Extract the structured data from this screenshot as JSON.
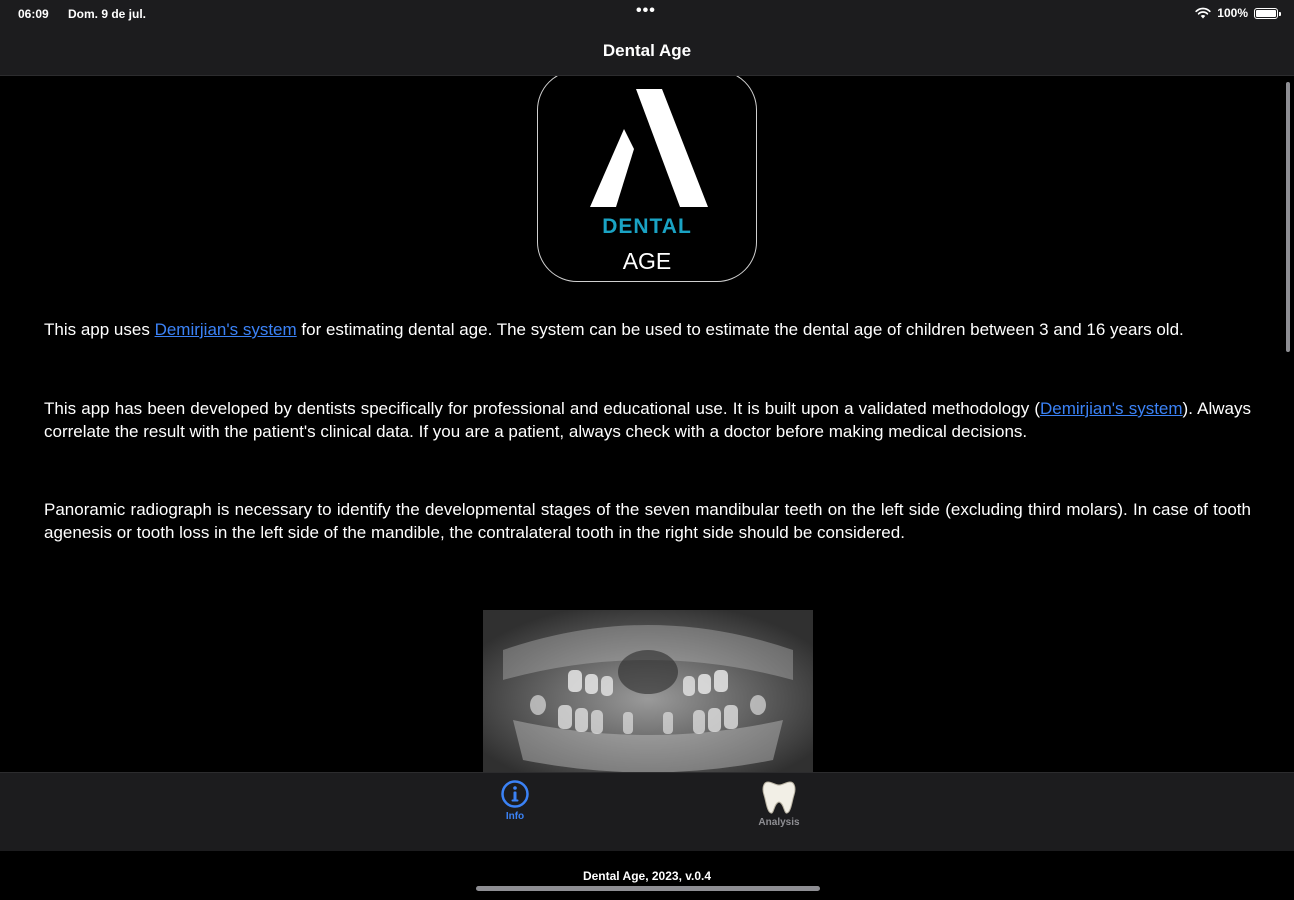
{
  "status_bar": {
    "time": "06:09",
    "date": "Dom. 9 de jul.",
    "dots": "•••",
    "battery": "100%"
  },
  "nav": {
    "title": "Dental Age"
  },
  "logo": {
    "word1": "DENTAL",
    "word2": "AGE",
    "accent_color": "#1aa3c4"
  },
  "content": {
    "para1": {
      "before": "This app uses ",
      "link": "Demirjian's system",
      "after": " for estimating dental age. The system can be used to estimate the dental age of children between 3 and 16 years old."
    },
    "para2": {
      "before": "This app has been developed by dentists specifically for professional and educational use. It is built upon a validated methodology (",
      "link": "Demirjian's system",
      "after": "). Always correlate the result with the patient's clinical data. If you are a patient, always check with a doctor before making medical decisions."
    },
    "para3": "Panoramic radiograph is necessary to identify the developmental stages of the seven mandibular teeth on the left side (excluding third molars). In case of tooth agenesis or tooth loss in the left side of the mandible, the contralateral tooth in the right side should be considered."
  },
  "tabs": [
    {
      "label": "Info",
      "icon": "info-circle-icon",
      "selected": true
    },
    {
      "label": "Analysis",
      "icon": "tooth-icon",
      "selected": false
    }
  ],
  "footer": {
    "text": "Dental Age, 2023, v.0.4"
  },
  "colors": {
    "link": "#3b82f6",
    "background": "#000000",
    "bar": "#1c1c1e"
  }
}
